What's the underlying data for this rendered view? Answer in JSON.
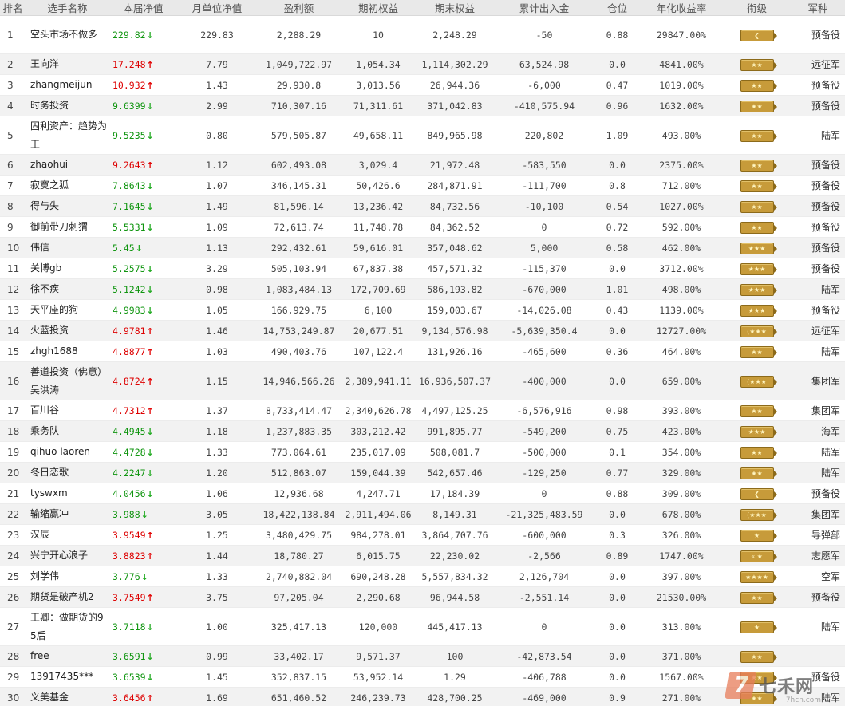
{
  "columns": {
    "rank": "排名",
    "name": "选手名称",
    "nav": "本届净值",
    "monthly_nav": "月单位净值",
    "profit": "盈利额",
    "initial_equity": "期初权益",
    "ending_equity": "期末权益",
    "cumulative_flow": "累计出入金",
    "position": "仓位",
    "annual_return": "年化收益率",
    "military_rank": "衔级",
    "army": "军种"
  },
  "colors": {
    "up": "#dd0000",
    "down": "#109510",
    "badge": "#c79b3a"
  },
  "rows": [
    {
      "rank": "1",
      "name": "空头市场不做多",
      "nav": "229.82",
      "dir": "down",
      "monthly": "229.83",
      "profit": "2,288.29",
      "initial": "10",
      "ending": "2,248.29",
      "flow": "-50",
      "position": "0.88",
      "annual": "29847.00%",
      "badge_icon": "chevron-badge",
      "army": "预备役"
    },
    {
      "rank": "2",
      "name": "王向洋",
      "nav": "17.248",
      "dir": "up",
      "monthly": "7.79",
      "profit": "1,049,722.97",
      "initial": "1,054.34",
      "ending": "1,114,302.29",
      "flow": "63,524.98",
      "position": "0.0",
      "annual": "4841.00%",
      "badge_icon": "two-star-badge",
      "army": "远征军"
    },
    {
      "rank": "3",
      "name": "zhangmeijun",
      "nav": "10.932",
      "dir": "up",
      "monthly": "1.43",
      "profit": "29,930.8",
      "initial": "3,013.56",
      "ending": "26,944.36",
      "flow": "-6,000",
      "position": "0.47",
      "annual": "1019.00%",
      "badge_icon": "two-star-badge",
      "army": "预备役"
    },
    {
      "rank": "4",
      "name": "时务投资",
      "nav": "9.6399",
      "dir": "down",
      "monthly": "2.99",
      "profit": "710,307.16",
      "initial": "71,311.61",
      "ending": "371,042.83",
      "flow": "-410,575.94",
      "position": "0.96",
      "annual": "1632.00%",
      "badge_icon": "two-star-badge",
      "army": "预备役"
    },
    {
      "rank": "5",
      "name": "固利资产：趋势为王",
      "nav": "9.5235",
      "dir": "down",
      "monthly": "0.80",
      "profit": "579,505.87",
      "initial": "49,658.11",
      "ending": "849,965.98",
      "flow": "220,802",
      "position": "1.09",
      "annual": "493.00%",
      "badge_icon": "two-star-badge",
      "army": "陆军"
    },
    {
      "rank": "6",
      "name": "zhaohui",
      "nav": "9.2643",
      "dir": "up",
      "monthly": "1.12",
      "profit": "602,493.08",
      "initial": "3,029.4",
      "ending": "21,972.48",
      "flow": "-583,550",
      "position": "0.0",
      "annual": "2375.00%",
      "badge_icon": "two-star-badge",
      "army": "预备役"
    },
    {
      "rank": "7",
      "name": "寂寞之狐",
      "nav": "7.8643",
      "dir": "down",
      "monthly": "1.07",
      "profit": "346,145.31",
      "initial": "50,426.6",
      "ending": "284,871.91",
      "flow": "-111,700",
      "position": "0.8",
      "annual": "712.00%",
      "badge_icon": "two-star-badge",
      "army": "预备役"
    },
    {
      "rank": "8",
      "name": "得与失",
      "nav": "7.1645",
      "dir": "down",
      "monthly": "1.49",
      "profit": "81,596.14",
      "initial": "13,236.42",
      "ending": "84,732.56",
      "flow": "-10,100",
      "position": "0.54",
      "annual": "1027.00%",
      "badge_icon": "two-star-badge",
      "army": "预备役"
    },
    {
      "rank": "9",
      "name": "御前带刀刺猬",
      "nav": "5.5331",
      "dir": "down",
      "monthly": "1.09",
      "profit": "72,613.74",
      "initial": "11,748.78",
      "ending": "84,362.52",
      "flow": "0",
      "position": "0.72",
      "annual": "592.00%",
      "badge_icon": "two-star-badge",
      "army": "预备役"
    },
    {
      "rank": "10",
      "name": "伟信",
      "nav": "5.45",
      "dir": "down",
      "monthly": "1.13",
      "profit": "292,432.61",
      "initial": "59,616.01",
      "ending": "357,048.62",
      "flow": "5,000",
      "position": "0.58",
      "annual": "462.00%",
      "badge_icon": "three-star-badge",
      "army": "预备役"
    },
    {
      "rank": "11",
      "name": "关博gb",
      "nav": "5.2575",
      "dir": "down",
      "monthly": "3.29",
      "profit": "505,103.94",
      "initial": "67,837.38",
      "ending": "457,571.32",
      "flow": "-115,370",
      "position": "0.0",
      "annual": "3712.00%",
      "badge_icon": "three-star-badge",
      "army": "预备役"
    },
    {
      "rank": "12",
      "name": "徐不疾",
      "nav": "5.1242",
      "dir": "down",
      "monthly": "0.98",
      "profit": "1,083,484.13",
      "initial": "172,709.69",
      "ending": "586,193.82",
      "flow": "-670,000",
      "position": "1.01",
      "annual": "498.00%",
      "badge_icon": "three-star-badge",
      "army": "陆军"
    },
    {
      "rank": "13",
      "name": "天平座的狗",
      "nav": "4.9983",
      "dir": "down",
      "monthly": "1.05",
      "profit": "166,929.75",
      "initial": "6,100",
      "ending": "159,003.67",
      "flow": "-14,026.08",
      "position": "0.43",
      "annual": "1139.00%",
      "badge_icon": "three-star-badge",
      "army": "预备役"
    },
    {
      "rank": "14",
      "name": "火蓝投资",
      "nav": "4.9781",
      "dir": "up",
      "monthly": "1.46",
      "profit": "14,753,249.87",
      "initial": "20,677.51",
      "ending": "9,134,576.98",
      "flow": "-5,639,350.4",
      "position": "0.0",
      "annual": "12727.00%",
      "badge_icon": "wreath-three-star-badge",
      "army": "远征军"
    },
    {
      "rank": "15",
      "name": "zhgh1688",
      "nav": "4.8877",
      "dir": "up",
      "monthly": "1.03",
      "profit": "490,403.76",
      "initial": "107,122.4",
      "ending": "131,926.16",
      "flow": "-465,600",
      "position": "0.36",
      "annual": "464.00%",
      "badge_icon": "two-star-badge",
      "army": "陆军"
    },
    {
      "rank": "16",
      "name": "善道投资（佛意）吴洪涛",
      "nav": "4.8724",
      "dir": "up",
      "monthly": "1.15",
      "profit": "14,946,566.26",
      "initial": "2,389,941.11",
      "ending": "16,936,507.37",
      "flow": "-400,000",
      "position": "0.0",
      "annual": "659.00%",
      "badge_icon": "wreath-three-star-badge",
      "army": "集团军"
    },
    {
      "rank": "17",
      "name": "百川谷",
      "nav": "4.7312",
      "dir": "up",
      "monthly": "1.37",
      "profit": "8,733,414.47",
      "initial": "2,340,626.78",
      "ending": "4,497,125.25",
      "flow": "-6,576,916",
      "position": "0.98",
      "annual": "393.00%",
      "badge_icon": "two-star-badge",
      "army": "集团军"
    },
    {
      "rank": "18",
      "name": "乘务队",
      "nav": "4.4945",
      "dir": "down",
      "monthly": "1.18",
      "profit": "1,237,883.35",
      "initial": "303,212.42",
      "ending": "991,895.77",
      "flow": "-549,200",
      "position": "0.75",
      "annual": "423.00%",
      "badge_icon": "three-star-badge",
      "army": "海军"
    },
    {
      "rank": "19",
      "name": "qihuo laoren",
      "nav": "4.4728",
      "dir": "down",
      "monthly": "1.33",
      "profit": "773,064.61",
      "initial": "235,017.09",
      "ending": "508,081.7",
      "flow": "-500,000",
      "position": "0.1",
      "annual": "354.00%",
      "badge_icon": "two-star-badge",
      "army": "陆军"
    },
    {
      "rank": "20",
      "name": "冬日恋歌",
      "nav": "4.2247",
      "dir": "down",
      "monthly": "1.20",
      "profit": "512,863.07",
      "initial": "159,044.39",
      "ending": "542,657.46",
      "flow": "-129,250",
      "position": "0.77",
      "annual": "329.00%",
      "badge_icon": "two-star-badge",
      "army": "陆军"
    },
    {
      "rank": "21",
      "name": "tyswxm",
      "nav": "4.0456",
      "dir": "down",
      "monthly": "1.06",
      "profit": "12,936.68",
      "initial": "4,247.71",
      "ending": "17,184.39",
      "flow": "0",
      "position": "0.88",
      "annual": "309.00%",
      "badge_icon": "chevron-badge",
      "army": "预备役"
    },
    {
      "rank": "22",
      "name": "输缩赢冲",
      "nav": "3.988",
      "dir": "down",
      "monthly": "3.05",
      "profit": "18,422,138.84",
      "initial": "2,911,494.06",
      "ending": "8,149.31",
      "flow": "-21,325,483.59",
      "position": "0.0",
      "annual": "678.00%",
      "badge_icon": "wreath-three-star-badge",
      "army": "集团军"
    },
    {
      "rank": "23",
      "name": "汉辰",
      "nav": "3.9549",
      "dir": "up",
      "monthly": "1.25",
      "profit": "3,480,429.75",
      "initial": "984,278.01",
      "ending": "3,864,707.76",
      "flow": "-600,000",
      "position": "0.3",
      "annual": "326.00%",
      "badge_icon": "one-star-badge",
      "army": "导弹部"
    },
    {
      "rank": "24",
      "name": "兴宁开心浪子",
      "nav": "3.8823",
      "dir": "up",
      "monthly": "1.44",
      "profit": "18,780.27",
      "initial": "6,015.75",
      "ending": "22,230.02",
      "flow": "-2,566",
      "position": "0.89",
      "annual": "1747.00%",
      "badge_icon": "double-chevron-star-badge",
      "army": "志愿军"
    },
    {
      "rank": "25",
      "name": "刘学伟",
      "nav": "3.776",
      "dir": "down",
      "monthly": "1.33",
      "profit": "2,740,882.04",
      "initial": "690,248.28",
      "ending": "5,557,834.32",
      "flow": "2,126,704",
      "position": "0.0",
      "annual": "397.00%",
      "badge_icon": "four-star-badge",
      "army": "空军"
    },
    {
      "rank": "26",
      "name": "期货是破产机2",
      "nav": "3.7549",
      "dir": "up",
      "monthly": "3.75",
      "profit": "97,205.04",
      "initial": "2,290.68",
      "ending": "96,944.58",
      "flow": "-2,551.14",
      "position": "0.0",
      "annual": "21530.00%",
      "badge_icon": "two-star-badge",
      "army": "预备役"
    },
    {
      "rank": "27",
      "name": "王卿：做期货的95后",
      "nav": "3.7118",
      "dir": "down",
      "monthly": "1.00",
      "profit": "325,417.13",
      "initial": "120,000",
      "ending": "445,417.13",
      "flow": "0",
      "position": "0.0",
      "annual": "313.00%",
      "badge_icon": "one-star-badge",
      "army": "陆军"
    },
    {
      "rank": "28",
      "name": "free",
      "nav": "3.6591",
      "dir": "down",
      "monthly": "0.99",
      "profit": "33,402.17",
      "initial": "9,571.37",
      "ending": "100",
      "flow": "-42,873.54",
      "position": "0.0",
      "annual": "371.00%",
      "badge_icon": "two-star-badge",
      "army": ""
    },
    {
      "rank": "29",
      "name": "13917435***",
      "nav": "3.6539",
      "dir": "down",
      "monthly": "1.45",
      "profit": "352,837.15",
      "initial": "53,952.14",
      "ending": "1.29",
      "flow": "-406,788",
      "position": "0.0",
      "annual": "1567.00%",
      "badge_icon": "two-star-badge",
      "army": "预备役"
    },
    {
      "rank": "30",
      "name": "义美基金",
      "nav": "3.6456",
      "dir": "up",
      "monthly": "1.69",
      "profit": "651,460.52",
      "initial": "246,239.73",
      "ending": "428,700.25",
      "flow": "-469,000",
      "position": "0.9",
      "annual": "271.00%",
      "badge_icon": "two-star-badge",
      "army": "陆军"
    }
  ],
  "badge_marks": {
    "chevron-badge": "❮",
    "two-star-badge": "★★",
    "three-star-badge": "★★★",
    "wreath-three-star-badge": "(★★★",
    "one-star-badge": "★",
    "double-chevron-star-badge": "« ★",
    "four-star-badge": "★★★★"
  },
  "watermark": {
    "brand": "七禾网",
    "url": "7hcn.com"
  }
}
